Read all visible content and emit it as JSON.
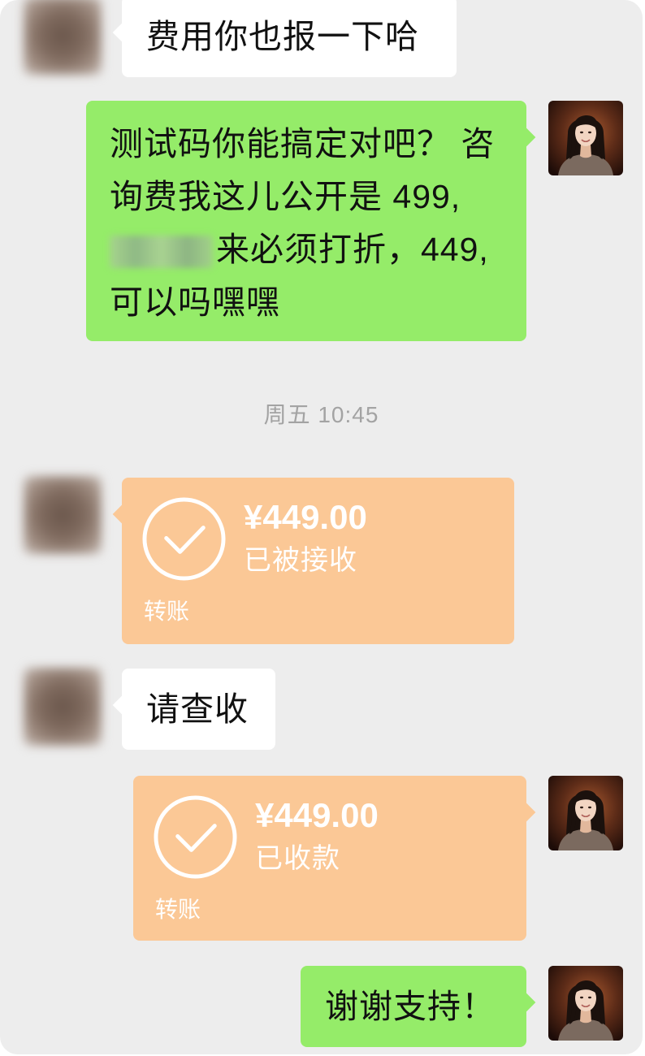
{
  "colors": {
    "chat_background": "#ededed",
    "incoming_bubble": "#ffffff",
    "outgoing_bubble": "#95ec69",
    "transfer_bubble": "#fbc896",
    "transfer_text": "#ffffff",
    "timestamp_text": "#a3a3a3"
  },
  "messages": [
    {
      "text": "费用你也报一下哈"
    },
    {
      "lines": [
        "测试码你能搞定对吧？ 咨",
        "询费我这儿公开是 499,",
        "来必须打折，449,",
        "可以吗嘿嘿"
      ]
    },
    {
      "timestamp": "周五 10:45"
    },
    {
      "amount": "¥449.00",
      "status": "已被接收",
      "label": "转账",
      "icon": "check-circle-icon"
    },
    {
      "text": "请查收"
    },
    {
      "amount": "¥449.00",
      "status": "已收款",
      "label": "转账",
      "icon": "check-circle-icon"
    },
    {
      "text": "谢谢支持！"
    }
  ]
}
